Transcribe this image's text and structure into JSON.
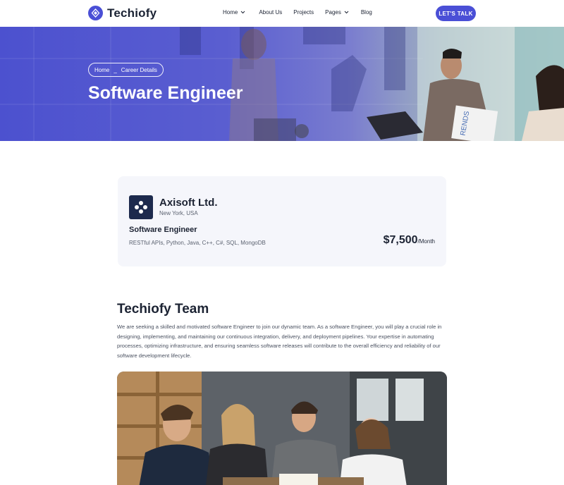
{
  "header": {
    "brand": "Techiofy",
    "nav": {
      "home": "Home",
      "about": "About Us",
      "projects": "Projects",
      "pages": "Pages",
      "blog": "Blog"
    },
    "cta": "LET'S TALK"
  },
  "hero": {
    "breadcrumb_home": "Home",
    "breadcrumb_sep": "_",
    "breadcrumb_current": "Career Details",
    "title": "Software Engineer",
    "photo_sign": "RENDS"
  },
  "job": {
    "company": "Axisoft Ltd.",
    "location": "New York, USA",
    "title": "Software Engineer",
    "skills": "RESTful APIs, Python, Java, C++, C#, SQL, MongoDB",
    "salary": "$7,500",
    "salary_unit": "/Month"
  },
  "team": {
    "title": "Techiofy Team",
    "description": "We are seeking a skilled and motivated software Engineer to join our dynamic team. As a software Engineer, you will play a crucial role in designing, implementing, and maintaining our continuous integration, delivery, and deployment pipelines. Your expertise in automating processes, optimizing infrastructure, and ensuring seamless software releases will contribute to the overall efficiency and reliability of our software development lifecycle."
  },
  "colors": {
    "accent": "#4a4fd6",
    "text": "#1c2333",
    "card_bg": "#f5f6fb",
    "company_logo_bg": "#1d2a4d"
  }
}
